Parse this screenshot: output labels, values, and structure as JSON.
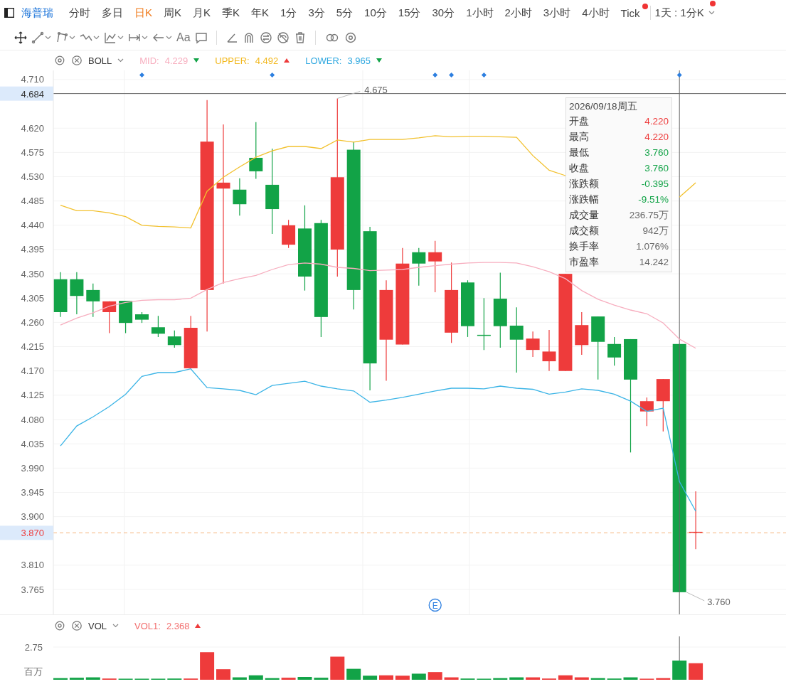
{
  "toolbar": {
    "stock": "海普瑞",
    "periods": [
      {
        "label": "分时",
        "selected": false,
        "dot": false
      },
      {
        "label": "多日",
        "selected": false,
        "dot": false
      },
      {
        "label": "日K",
        "selected": true,
        "dot": false
      },
      {
        "label": "周K",
        "selected": false,
        "dot": false
      },
      {
        "label": "月K",
        "selected": false,
        "dot": false
      },
      {
        "label": "季K",
        "selected": false,
        "dot": false
      },
      {
        "label": "年K",
        "selected": false,
        "dot": false
      },
      {
        "label": "1分",
        "selected": false,
        "dot": false
      },
      {
        "label": "3分",
        "selected": false,
        "dot": false
      },
      {
        "label": "5分",
        "selected": false,
        "dot": false
      },
      {
        "label": "10分",
        "selected": false,
        "dot": false
      },
      {
        "label": "15分",
        "selected": false,
        "dot": false
      },
      {
        "label": "30分",
        "selected": false,
        "dot": false
      },
      {
        "label": "1小时",
        "selected": false,
        "dot": false
      },
      {
        "label": "2小时",
        "selected": false,
        "dot": false
      },
      {
        "label": "3小时",
        "selected": false,
        "dot": false
      },
      {
        "label": "4小时",
        "selected": false,
        "dot": false
      },
      {
        "label": "Tick",
        "selected": false,
        "dot": true
      }
    ],
    "interval": {
      "label": "1天 : 1分K",
      "dot": true
    }
  },
  "drawing_tools": {
    "text_tool": "Aa"
  },
  "main_pane": {
    "indicator": {
      "name": "BOLL",
      "values": [
        {
          "label": "MID:",
          "value": "4.229",
          "color": "#f7aebf",
          "rising": false
        },
        {
          "label": "UPPER:",
          "value": "4.492",
          "color": "#f2b81e",
          "rising": true
        },
        {
          "label": "LOWER:",
          "value": "3.965",
          "color": "#2fa8e0",
          "rising": false
        }
      ]
    },
    "tooltip": {
      "date": "2026/09/18周五",
      "rows": [
        {
          "label": "开盘",
          "value": "4.220",
          "color": "#ee3b3b"
        },
        {
          "label": "最高",
          "value": "4.220",
          "color": "#ee3b3b"
        },
        {
          "label": "最低",
          "value": "3.760",
          "color": "#12a347"
        },
        {
          "label": "收盘",
          "value": "3.760",
          "color": "#12a347"
        },
        {
          "label": "涨跌额",
          "value": "-0.395",
          "color": "#12a347"
        },
        {
          "label": "涨跌幅",
          "value": "-9.51%",
          "color": "#12a347"
        },
        {
          "label": "成交量",
          "value": "236.75万",
          "color": "#666666"
        },
        {
          "label": "成交额",
          "value": "942万",
          "color": "#666666"
        },
        {
          "label": "换手率",
          "value": "1.076%",
          "color": "#666666"
        },
        {
          "label": "市盈率",
          "value": "14.242",
          "color": "#666666"
        }
      ]
    },
    "crosshair_label": "4.684",
    "last_price_label": "3.870",
    "high_label": "4.675",
    "low_label": "3.760",
    "event_badge": "E",
    "chart_data": {
      "type": "line",
      "series": [
        {
          "color": "#f7aebf",
          "values": [
            4.255,
            4.268,
            4.278,
            4.29,
            4.297,
            4.301,
            4.302,
            4.302,
            4.305,
            4.321,
            4.334,
            4.341,
            4.347,
            4.358,
            4.367,
            4.37,
            4.368,
            4.362,
            4.36,
            4.356,
            4.357,
            4.358,
            4.362,
            4.365,
            4.368,
            4.37,
            4.371,
            4.371,
            4.37,
            4.363,
            4.354,
            4.341,
            4.319,
            4.303,
            4.292,
            4.283,
            4.276,
            4.259,
            4.229,
            4.212
          ]
        },
        {
          "color": "#f2c12e",
          "values": [
            4.477,
            4.467,
            4.467,
            4.463,
            4.456,
            4.44,
            4.438,
            4.437,
            4.435,
            4.503,
            4.529,
            4.548,
            4.566,
            4.578,
            4.586,
            4.586,
            4.582,
            4.598,
            4.594,
            4.599,
            4.599,
            4.599,
            4.602,
            4.606,
            4.604,
            4.605,
            4.605,
            4.604,
            4.603,
            4.569,
            4.542,
            4.532,
            null,
            null,
            null,
            null,
            null,
            null,
            4.492,
            4.519
          ]
        },
        {
          "color": "#3bb4e6",
          "values": [
            4.031,
            4.068,
            4.085,
            4.104,
            4.127,
            4.16,
            4.167,
            4.167,
            4.174,
            4.139,
            4.137,
            4.134,
            4.126,
            4.143,
            4.147,
            4.151,
            4.142,
            4.137,
            4.133,
            4.112,
            4.116,
            4.121,
            4.127,
            4.133,
            4.138,
            4.138,
            4.137,
            4.142,
            4.138,
            4.136,
            4.127,
            4.131,
            4.137,
            4.134,
            4.127,
            4.114,
            4.095,
            4.101,
            3.965,
            3.91
          ]
        }
      ],
      "ylim": [
        3.719,
        4.727
      ],
      "yticks": [
        {
          "value": 4.71,
          "label": "4.710"
        },
        {
          "value": 4.62,
          "label": "4.620"
        },
        {
          "value": 4.575,
          "label": "4.575"
        },
        {
          "value": 4.53,
          "label": "4.530"
        },
        {
          "value": 4.485,
          "label": "4.485"
        },
        {
          "value": 4.44,
          "label": "4.440"
        },
        {
          "value": 4.395,
          "label": "4.395"
        },
        {
          "value": 4.35,
          "label": "4.350"
        },
        {
          "value": 4.305,
          "label": "4.305"
        },
        {
          "value": 4.26,
          "label": "4.260"
        },
        {
          "value": 4.215,
          "label": "4.215"
        },
        {
          "value": 4.17,
          "label": "4.170"
        },
        {
          "value": 4.125,
          "label": "4.125"
        },
        {
          "value": 4.08,
          "label": "4.080"
        },
        {
          "value": 4.035,
          "label": "4.035"
        },
        {
          "value": 3.99,
          "label": "3.990"
        },
        {
          "value": 3.945,
          "label": "3.945"
        },
        {
          "value": 3.9,
          "label": "3.900"
        },
        {
          "value": 3.81,
          "label": "3.810"
        },
        {
          "value": 3.765,
          "label": "3.765"
        }
      ],
      "grid": true
    }
  },
  "volume_pane": {
    "indicator": {
      "name": "VOL",
      "values": [
        {
          "label": "VOL1:",
          "value": "2.368",
          "color": "#f26d6d",
          "rising": true
        }
      ]
    },
    "axis_label": "2.75",
    "unit": "百万"
  }
}
